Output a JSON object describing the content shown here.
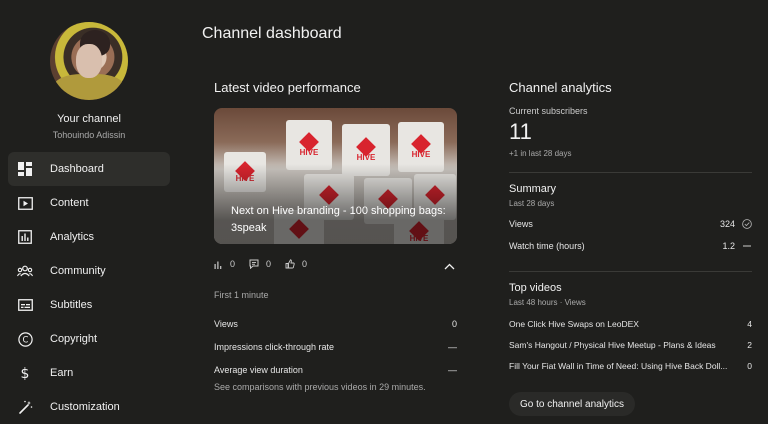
{
  "sidebar": {
    "channel_title": "Your channel",
    "channel_handle": "Tohouindo Adissin",
    "items": [
      {
        "label": "Dashboard",
        "icon": "dashboard-icon",
        "active": true
      },
      {
        "label": "Content",
        "icon": "content-icon"
      },
      {
        "label": "Analytics",
        "icon": "analytics-icon"
      },
      {
        "label": "Community",
        "icon": "community-icon"
      },
      {
        "label": "Subtitles",
        "icon": "subtitles-icon"
      },
      {
        "label": "Copyright",
        "icon": "copyright-icon"
      },
      {
        "label": "Earn",
        "icon": "earn-icon"
      },
      {
        "label": "Customization",
        "icon": "customization-icon"
      }
    ]
  },
  "page": {
    "title": "Channel dashboard"
  },
  "latest_video": {
    "section_title": "Latest video performance",
    "video_title_line1": "Next on Hive branding - 100 shopping bags:",
    "video_title_line2": "3speak",
    "thumbnail_brand": "HIVE",
    "views_count": "0",
    "comments_count": "0",
    "likes_count": "0",
    "period_label": "First 1 minute",
    "metrics": [
      {
        "label": "Views",
        "value": "0"
      },
      {
        "label": "Impressions click-through rate",
        "value": "—"
      },
      {
        "label": "Average view duration",
        "value": "—"
      }
    ],
    "note": "See comparisons with previous videos in 29 minutes."
  },
  "analytics": {
    "section_title": "Channel analytics",
    "subscribers_label": "Current subscribers",
    "subscribers_count": "11",
    "subscribers_change": "+1 in last 28 days",
    "summary_title": "Summary",
    "summary_period": "Last 28 days",
    "summary_rows": [
      {
        "label": "Views",
        "value": "324",
        "trend_icon": "check-circle-icon"
      },
      {
        "label": "Watch time (hours)",
        "value": "1.2",
        "trend_icon": "dash-icon"
      }
    ],
    "top_videos_title": "Top videos",
    "top_videos_period": "Last 48 hours · Views",
    "top_videos": [
      {
        "title": "One Click Hive Swaps on LeoDEX",
        "views": "4"
      },
      {
        "title": "Sam's Hangout / Physical Hive Meetup - Plans & Ideas",
        "views": "2"
      },
      {
        "title": "Fill Your Fiat Wall in Time of Need: Using Hive Back Doll...",
        "views": "0"
      }
    ],
    "go_button": "Go to channel analytics"
  },
  "colors": {
    "background": "#1f1f1d",
    "active_nav": "#2e2e2b",
    "hive_red": "#d8242e"
  }
}
